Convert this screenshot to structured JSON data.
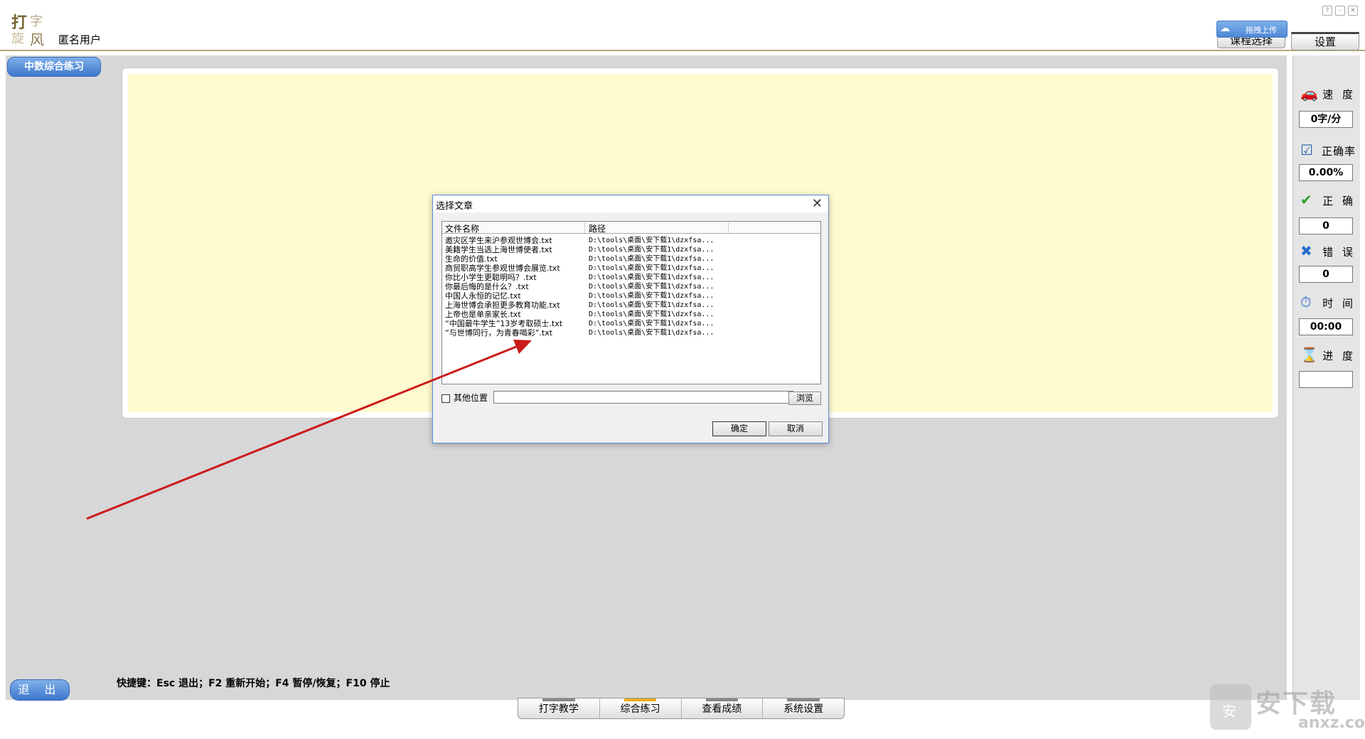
{
  "app": {
    "logo_chars": [
      "打",
      "字",
      "旋",
      "风"
    ],
    "username": "匿名用户",
    "upload_label": "拖拽上传",
    "course_select_label": "课程选择",
    "settings_label": "设置",
    "window_controls": [
      "?",
      "–",
      "✕"
    ]
  },
  "course_tab": "中数综合练习",
  "stats": {
    "speed": {
      "label": "速 度",
      "value": "0字/分",
      "icon": "car-icon"
    },
    "accuracy": {
      "label": "正确率",
      "value": "0.00%",
      "icon": "check-icon"
    },
    "correct": {
      "label": "正 确",
      "value": "0",
      "icon": "correct-icon"
    },
    "wrong": {
      "label": "错 误",
      "value": "0",
      "icon": "wrong-icon"
    },
    "time": {
      "label": "时 间",
      "value": "00:00",
      "icon": "clock-icon"
    },
    "progress": {
      "label": "进 度",
      "value": "",
      "icon": "hourglass-icon"
    }
  },
  "exit_label": "退 出",
  "shortcuts": "快捷键：Esc 退出；F2 重新开始；F4 暂停/恢复；F10 停止",
  "bottom_nav": [
    "打字教学",
    "综合练习",
    "查看成绩",
    "系统设置"
  ],
  "dialog": {
    "title": "选择文章",
    "col_name": "文件名称",
    "col_path": "路径",
    "files": [
      {
        "name": "邀灾区学生来沪参观世博会.txt",
        "path": "D:\\tools\\桌面\\安下载1\\dzxfsa..."
      },
      {
        "name": "美籍学生当选上海世博使者.txt",
        "path": "D:\\tools\\桌面\\安下载1\\dzxfsa..."
      },
      {
        "name": "生命的价值.txt",
        "path": "D:\\tools\\桌面\\安下载1\\dzxfsa..."
      },
      {
        "name": "商贸职高学生参观世博会展览.txt",
        "path": "D:\\tools\\桌面\\安下载1\\dzxfsa..."
      },
      {
        "name": "你比小学生更聪明吗？.txt",
        "path": "D:\\tools\\桌面\\安下载1\\dzxfsa..."
      },
      {
        "name": "你最后悔的是什么？.txt",
        "path": "D:\\tools\\桌面\\安下载1\\dzxfsa..."
      },
      {
        "name": "中国人永恒的记忆.txt",
        "path": "D:\\tools\\桌面\\安下载1\\dzxfsa..."
      },
      {
        "name": "上海世博会承担更多教育功能.txt",
        "path": "D:\\tools\\桌面\\安下载1\\dzxfsa..."
      },
      {
        "name": "上帝也是单亲家长.txt",
        "path": "D:\\tools\\桌面\\安下载1\\dzxfsa..."
      },
      {
        "name": "“中国最牛学生”13岁考取硕士.txt",
        "path": "D:\\tools\\桌面\\安下载1\\dzxfsa..."
      },
      {
        "name": "“与世博同行，为青春喝彩”.txt",
        "path": "D:\\tools\\桌面\\安下载1\\dzxfsa..."
      }
    ],
    "other_location_label": "其他位置",
    "other_location_value": "",
    "browse_label": "浏览",
    "ok_label": "确定",
    "cancel_label": "取消"
  },
  "watermark": {
    "main": "安下载",
    "sub": "anxz.com",
    "badge": "安"
  },
  "colors": {
    "accent": "#4f88d6",
    "text_area": "#fffad0",
    "arrow": "#cc1a1a",
    "active_tab": "#e8b020"
  }
}
